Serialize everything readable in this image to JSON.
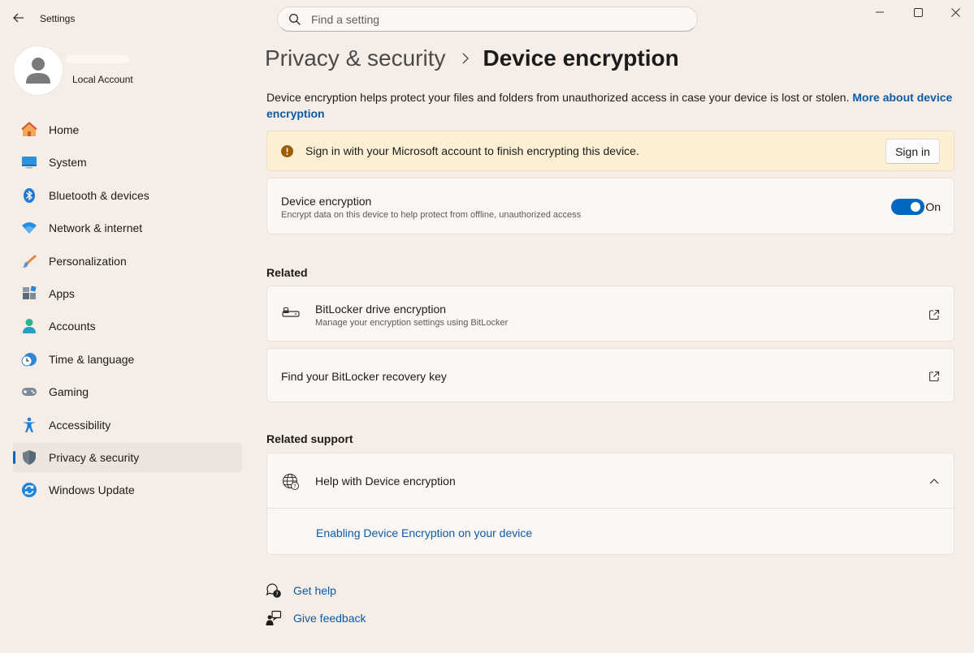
{
  "window": {
    "title": "Settings",
    "controls": {
      "minimize": "minimize-icon",
      "maximize": "maximize-icon",
      "close": "close-icon"
    }
  },
  "search": {
    "placeholder": "Find a setting",
    "value": ""
  },
  "profile": {
    "account_type": "Local Account"
  },
  "sidebar": {
    "items": [
      {
        "label": "Home",
        "icon": "home-icon"
      },
      {
        "label": "System",
        "icon": "system-icon"
      },
      {
        "label": "Bluetooth & devices",
        "icon": "bluetooth-icon"
      },
      {
        "label": "Network & internet",
        "icon": "wifi-icon"
      },
      {
        "label": "Personalization",
        "icon": "brush-icon"
      },
      {
        "label": "Apps",
        "icon": "apps-icon"
      },
      {
        "label": "Accounts",
        "icon": "person-icon"
      },
      {
        "label": "Time & language",
        "icon": "clock-globe-icon"
      },
      {
        "label": "Gaming",
        "icon": "gamepad-icon"
      },
      {
        "label": "Accessibility",
        "icon": "accessibility-icon"
      },
      {
        "label": "Privacy & security",
        "icon": "shield-icon",
        "selected": true
      },
      {
        "label": "Windows Update",
        "icon": "sync-icon"
      }
    ],
    "accent": "#0067c0"
  },
  "breadcrumb": {
    "parent": "Privacy & security",
    "current": "Device encryption"
  },
  "description": {
    "text": "Device encryption helps protect your files and folders from unauthorized access in case your device is lost or stolen.",
    "link": "More about device encryption"
  },
  "banner": {
    "text": "Sign in with your Microsoft account to finish encrypting this device.",
    "button": "Sign in",
    "color": "#fbf0d3"
  },
  "device_encryption": {
    "title": "Device encryption",
    "subtitle": "Encrypt data on this device to help protect from offline, unauthorized access",
    "toggle_state": "On",
    "toggle_on": true
  },
  "related": {
    "heading": "Related",
    "items": [
      {
        "title": "BitLocker drive encryption",
        "subtitle": "Manage your encryption settings using BitLocker",
        "icon": "drive-lock-icon"
      },
      {
        "title": "Find your BitLocker recovery key",
        "subtitle": ""
      }
    ]
  },
  "related_support": {
    "heading": "Related support",
    "item_title": "Help with Device encryption",
    "expanded": true,
    "link": "Enabling Device Encryption on your device"
  },
  "footer": {
    "get_help": "Get help",
    "give_feedback": "Give feedback"
  }
}
